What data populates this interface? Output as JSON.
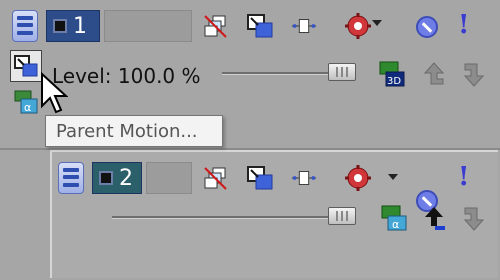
{
  "track1": {
    "number": "1",
    "level_label": "Level: 100.0 %",
    "tooltip": "Parent Motion..."
  },
  "track2": {
    "number": "2"
  },
  "icons": {
    "collapse": "collapse-track-icon",
    "film": "film-strip-icon",
    "composite": "composite-mode-icon",
    "parent_motion": "parent-motion-icon",
    "pan_crop": "pan-crop-icon",
    "track_fx": "track-fx-icon",
    "mute": "mute-icon",
    "solo": "solo-icon",
    "alpha": "alpha-compositing-icon",
    "three_d": "3d-compositing-icon",
    "make_parent": "make-compositing-parent-icon",
    "make_child": "make-compositing-child-icon"
  },
  "colors": {
    "panel_bg": "#a6a6a6",
    "track1_num_bg": "#2d4c8a",
    "track2_num_bg": "#2b5f6a",
    "tooltip_bg": "#f3f3f3"
  }
}
